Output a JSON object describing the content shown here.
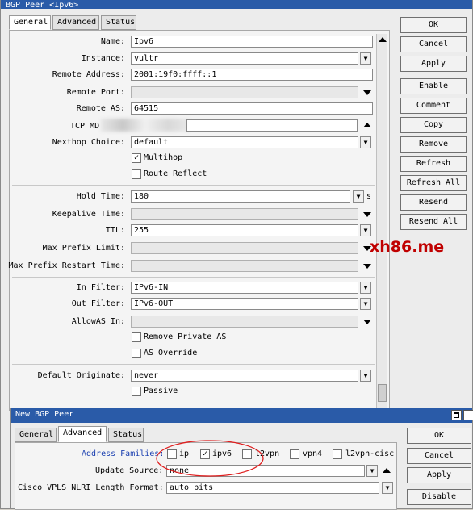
{
  "main_window": {
    "title": "BGP Peer <Ipv6>",
    "tabs": [
      "General",
      "Advanced",
      "Status"
    ],
    "fields": {
      "name_label": "Name:",
      "name_value": "Ipv6",
      "instance_label": "Instance:",
      "instance_value": "vultr",
      "remote_address_label": "Remote Address:",
      "remote_address_value": "2001:19f0:ffff::1",
      "remote_port_label": "Remote Port:",
      "remote_port_value": "",
      "remote_as_label": "Remote AS:",
      "remote_as_value": "64515",
      "tcp_md5_label": "TCP MD",
      "nexthop_label": "Nexthop Choice:",
      "nexthop_value": "default",
      "multihop_label": "Multihop",
      "multihop_checked": true,
      "route_reflect_label": "Route Reflect",
      "route_reflect_checked": false,
      "hold_time_label": "Hold Time:",
      "hold_time_value": "180",
      "hold_time_unit": "s",
      "keepalive_label": "Keepalive Time:",
      "ttl_label": "TTL:",
      "ttl_value": "255",
      "max_prefix_label": "Max Prefix Limit:",
      "max_prefix_restart_label": "Max Prefix Restart Time:",
      "in_filter_label": "In Filter:",
      "in_filter_value": "IPv6-IN",
      "out_filter_label": "Out Filter:",
      "out_filter_value": "IPv6-OUT",
      "allowas_label": "AllowAS In:",
      "remove_private_as_label": "Remove Private AS",
      "as_override_label": "AS Override",
      "default_originate_label": "Default Originate:",
      "default_originate_value": "never",
      "passive_label": "Passive"
    },
    "buttons": [
      "OK",
      "Cancel",
      "Apply",
      "Enable",
      "Comment",
      "Copy",
      "Remove",
      "Refresh",
      "Refresh All",
      "Resend",
      "Resend All"
    ]
  },
  "watermark": "xh86.me",
  "new_window": {
    "title": "New BGP Peer",
    "tabs": [
      "General",
      "Advanced",
      "Status"
    ],
    "address_families_label": "Address Families:",
    "families": [
      {
        "label": "ip",
        "checked": false
      },
      {
        "label": "ipv6",
        "checked": true
      },
      {
        "label": "l2vpn",
        "checked": false
      },
      {
        "label": "vpn4",
        "checked": false
      },
      {
        "label": "l2vpn-cisco",
        "checked": false
      }
    ],
    "update_source_label": "Update Source:",
    "update_source_value": "none",
    "cisco_vpls_label": "Cisco VPLS NLRI Length Format:",
    "cisco_vpls_value": "auto bits",
    "buttons": [
      "OK",
      "Cancel",
      "Apply",
      "Disable"
    ]
  },
  "colors": {
    "title_bar": "#2a5ba8",
    "watermark": "#c00000",
    "highlight_ellipse": "#e02020"
  }
}
